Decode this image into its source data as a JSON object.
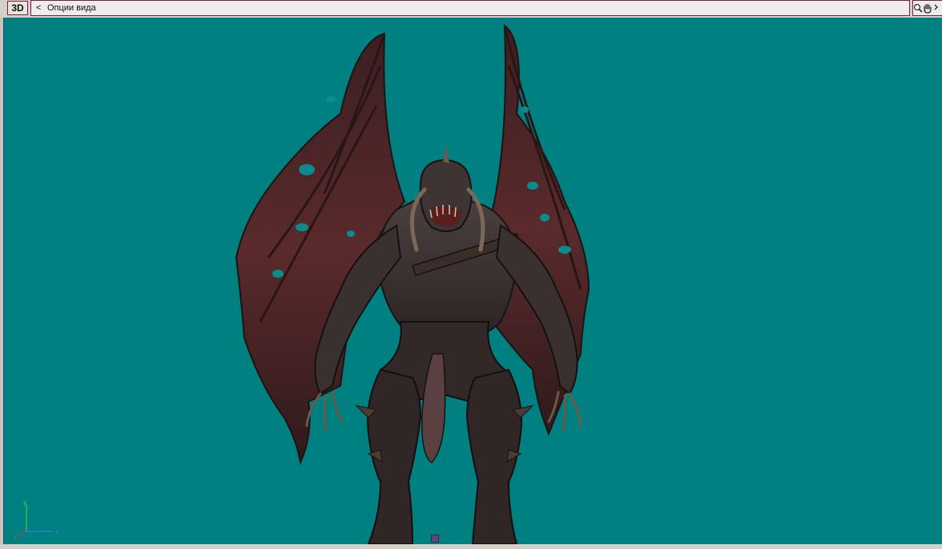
{
  "toolbar": {
    "view_mode_label": "3D",
    "back_label": "<",
    "view_title": "Опции вида",
    "tools": [
      "zoom-icon",
      "pan-hand-icon"
    ]
  },
  "viewport": {
    "background_color": "#008080",
    "model": "winged-demon-3d-model",
    "axis_labels": {
      "x": "x",
      "y": "y",
      "z": "z"
    }
  }
}
